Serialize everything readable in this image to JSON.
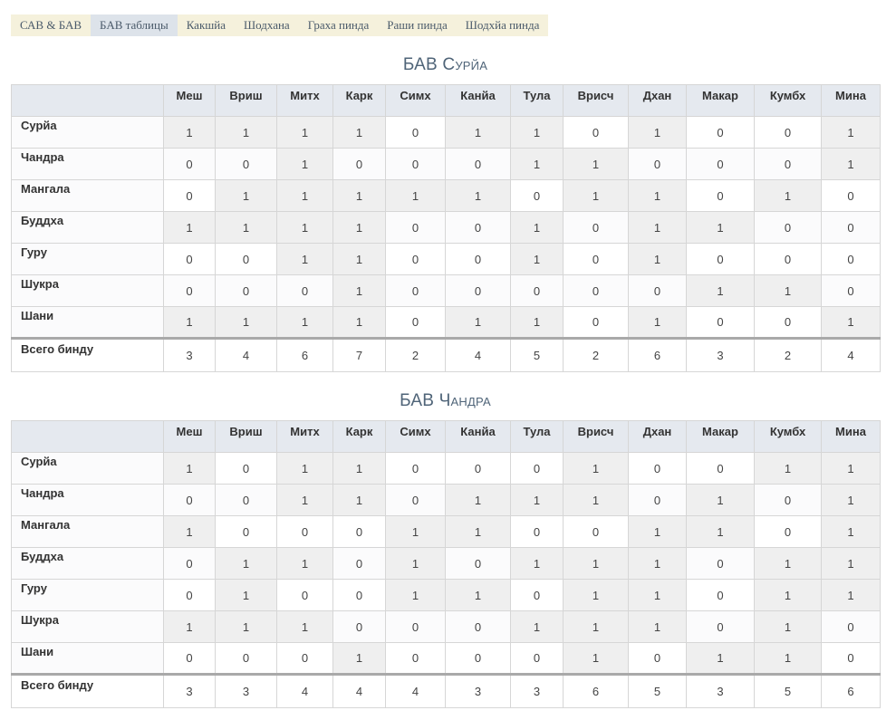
{
  "tabs": [
    {
      "label": "САВ & БАВ",
      "active": false
    },
    {
      "label": "БАВ таблицы",
      "active": true
    },
    {
      "label": "Какшйа",
      "active": false
    },
    {
      "label": "Шодхана",
      "active": false
    },
    {
      "label": "Граха пинда",
      "active": false
    },
    {
      "label": "Раши пинда",
      "active": false
    },
    {
      "label": "Шодхйа пинда",
      "active": false
    }
  ],
  "sections": [
    {
      "title": "БАВ Сурйа",
      "columns": [
        "Меш",
        "Вриш",
        "Митх",
        "Карк",
        "Симх",
        "Канйа",
        "Тула",
        "Врисч",
        "Дхан",
        "Макар",
        "Кумбх",
        "Мина"
      ],
      "rows": [
        {
          "label": "Сурйа",
          "values": [
            "1",
            "1",
            "1",
            "1",
            "0",
            "1",
            "1",
            "0",
            "1",
            "0",
            "0",
            "1"
          ]
        },
        {
          "label": "Чандра",
          "values": [
            "0",
            "0",
            "1",
            "0",
            "0",
            "0",
            "1",
            "1",
            "0",
            "0",
            "0",
            "1"
          ]
        },
        {
          "label": "Мангала",
          "values": [
            "0",
            "1",
            "1",
            "1",
            "1",
            "1",
            "0",
            "1",
            "1",
            "0",
            "1",
            "0"
          ]
        },
        {
          "label": "Буддха",
          "values": [
            "1",
            "1",
            "1",
            "1",
            "0",
            "0",
            "1",
            "0",
            "1",
            "1",
            "0",
            "0"
          ]
        },
        {
          "label": "Гуру",
          "values": [
            "0",
            "0",
            "1",
            "1",
            "0",
            "0",
            "1",
            "0",
            "1",
            "0",
            "0",
            "0"
          ]
        },
        {
          "label": "Шукра",
          "values": [
            "0",
            "0",
            "0",
            "1",
            "0",
            "0",
            "0",
            "0",
            "0",
            "1",
            "1",
            "0"
          ]
        },
        {
          "label": "Шани",
          "values": [
            "1",
            "1",
            "1",
            "1",
            "0",
            "1",
            "1",
            "0",
            "1",
            "0",
            "0",
            "1"
          ]
        }
      ],
      "total_label": "Всего бинду",
      "totals": [
        "3",
        "4",
        "6",
        "7",
        "2",
        "4",
        "5",
        "2",
        "6",
        "3",
        "2",
        "4"
      ]
    },
    {
      "title": "БАВ Чандра",
      "columns": [
        "Меш",
        "Вриш",
        "Митх",
        "Карк",
        "Симх",
        "Канйа",
        "Тула",
        "Врисч",
        "Дхан",
        "Макар",
        "Кумбх",
        "Мина"
      ],
      "rows": [
        {
          "label": "Сурйа",
          "values": [
            "1",
            "0",
            "1",
            "1",
            "0",
            "0",
            "0",
            "1",
            "0",
            "0",
            "1",
            "1"
          ]
        },
        {
          "label": "Чандра",
          "values": [
            "0",
            "0",
            "1",
            "1",
            "0",
            "1",
            "1",
            "1",
            "0",
            "1",
            "0",
            "1"
          ]
        },
        {
          "label": "Мангала",
          "values": [
            "1",
            "0",
            "0",
            "0",
            "1",
            "1",
            "0",
            "0",
            "1",
            "1",
            "0",
            "1"
          ]
        },
        {
          "label": "Буддха",
          "values": [
            "0",
            "1",
            "1",
            "0",
            "1",
            "0",
            "1",
            "1",
            "1",
            "0",
            "1",
            "1"
          ]
        },
        {
          "label": "Гуру",
          "values": [
            "0",
            "1",
            "0",
            "0",
            "1",
            "1",
            "0",
            "1",
            "1",
            "0",
            "1",
            "1"
          ]
        },
        {
          "label": "Шукра",
          "values": [
            "1",
            "1",
            "1",
            "0",
            "0",
            "0",
            "1",
            "1",
            "1",
            "0",
            "1",
            "0"
          ]
        },
        {
          "label": "Шани",
          "values": [
            "0",
            "0",
            "0",
            "1",
            "0",
            "0",
            "0",
            "1",
            "0",
            "1",
            "1",
            "0"
          ]
        }
      ],
      "total_label": "Всего бинду",
      "totals": [
        "3",
        "3",
        "4",
        "4",
        "4",
        "3",
        "3",
        "6",
        "5",
        "3",
        "5",
        "6"
      ]
    }
  ]
}
